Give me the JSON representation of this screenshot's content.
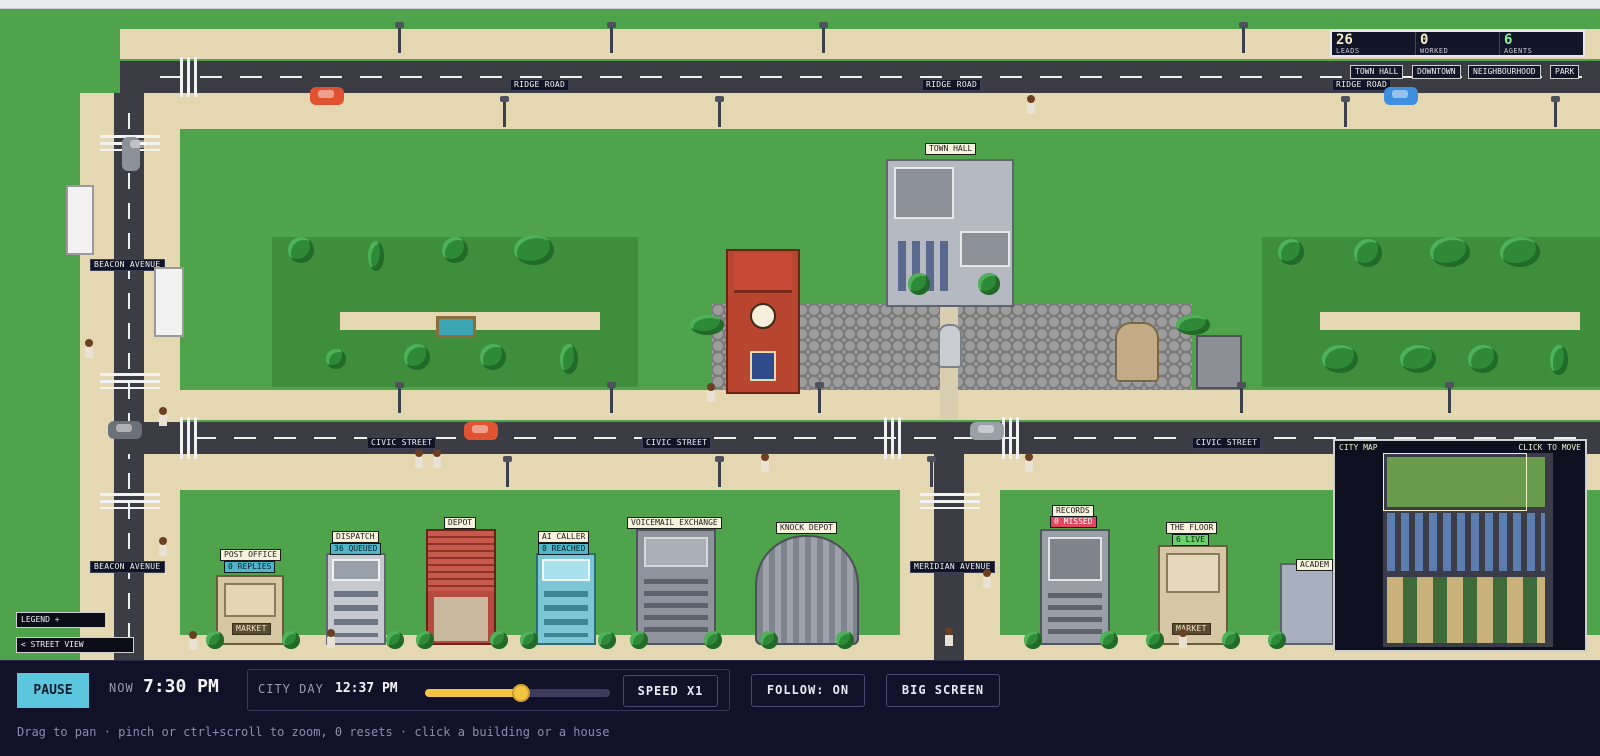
{
  "stats": {
    "leads": {
      "value": "26",
      "label": "LEADS"
    },
    "worked": {
      "value": "0",
      "label": "WORKED"
    },
    "agents": {
      "value": "6",
      "label": "AGENTS"
    }
  },
  "destinations": [
    "TOWN HALL",
    "DOWNTOWN",
    "NEIGHBOURHOOD",
    "PARK"
  ],
  "streets": {
    "ridge": "RIDGE ROAD",
    "civic": "CIVIC STREET",
    "beacon": "BEACON AVENUE",
    "meridian": "MERIDIAN AVENUE"
  },
  "buildings": {
    "town_hall": "TOWN HALL",
    "post_office": {
      "name": "POST OFFICE",
      "status": "0 REPLIES"
    },
    "dispatch": {
      "name": "DISPATCH",
      "status": "36 QUEUED"
    },
    "depot": {
      "name": "DEPOT"
    },
    "ai_caller": {
      "name": "AI CALLER",
      "status": "0 REACHED"
    },
    "voicemail": {
      "name": "VOICEMAIL EXCHANGE"
    },
    "knock_depot": {
      "name": "KNOCK DEPOT"
    },
    "records": {
      "name": "RECORDS",
      "status": "0 MISSED"
    },
    "the_floor": {
      "name": "THE FLOOR",
      "status": "6 LIVE"
    },
    "academy": {
      "name": "ACADEM"
    }
  },
  "signs": {
    "market": "MARKET",
    "market2": "MARKET"
  },
  "minimap": {
    "title": "CITY MAP",
    "hint": "CLICK TO MOVE"
  },
  "controls": {
    "legend": "LEGEND +",
    "street_view": "< STREET VIEW",
    "pause": "PAUSE",
    "now_label": "NOW",
    "now_time": "7:30 PM",
    "city_day_label": "CITY DAY",
    "city_day_time": "12:37 PM",
    "day_progress": 0.52,
    "speed": "SPEED X1",
    "follow": "FOLLOW: ON",
    "big_screen": "BIG SCREEN",
    "hint": "Drag to pan · pinch or ctrl+scroll to zoom, 0 resets · click a building or a house"
  },
  "colors": {
    "grass": "#4fa34a",
    "road": "#3c3c44",
    "sidewalk": "#e6d7b3",
    "accent_blue": "#5bc7df",
    "accent_yellow": "#f5c542",
    "panel": "#12112a"
  }
}
